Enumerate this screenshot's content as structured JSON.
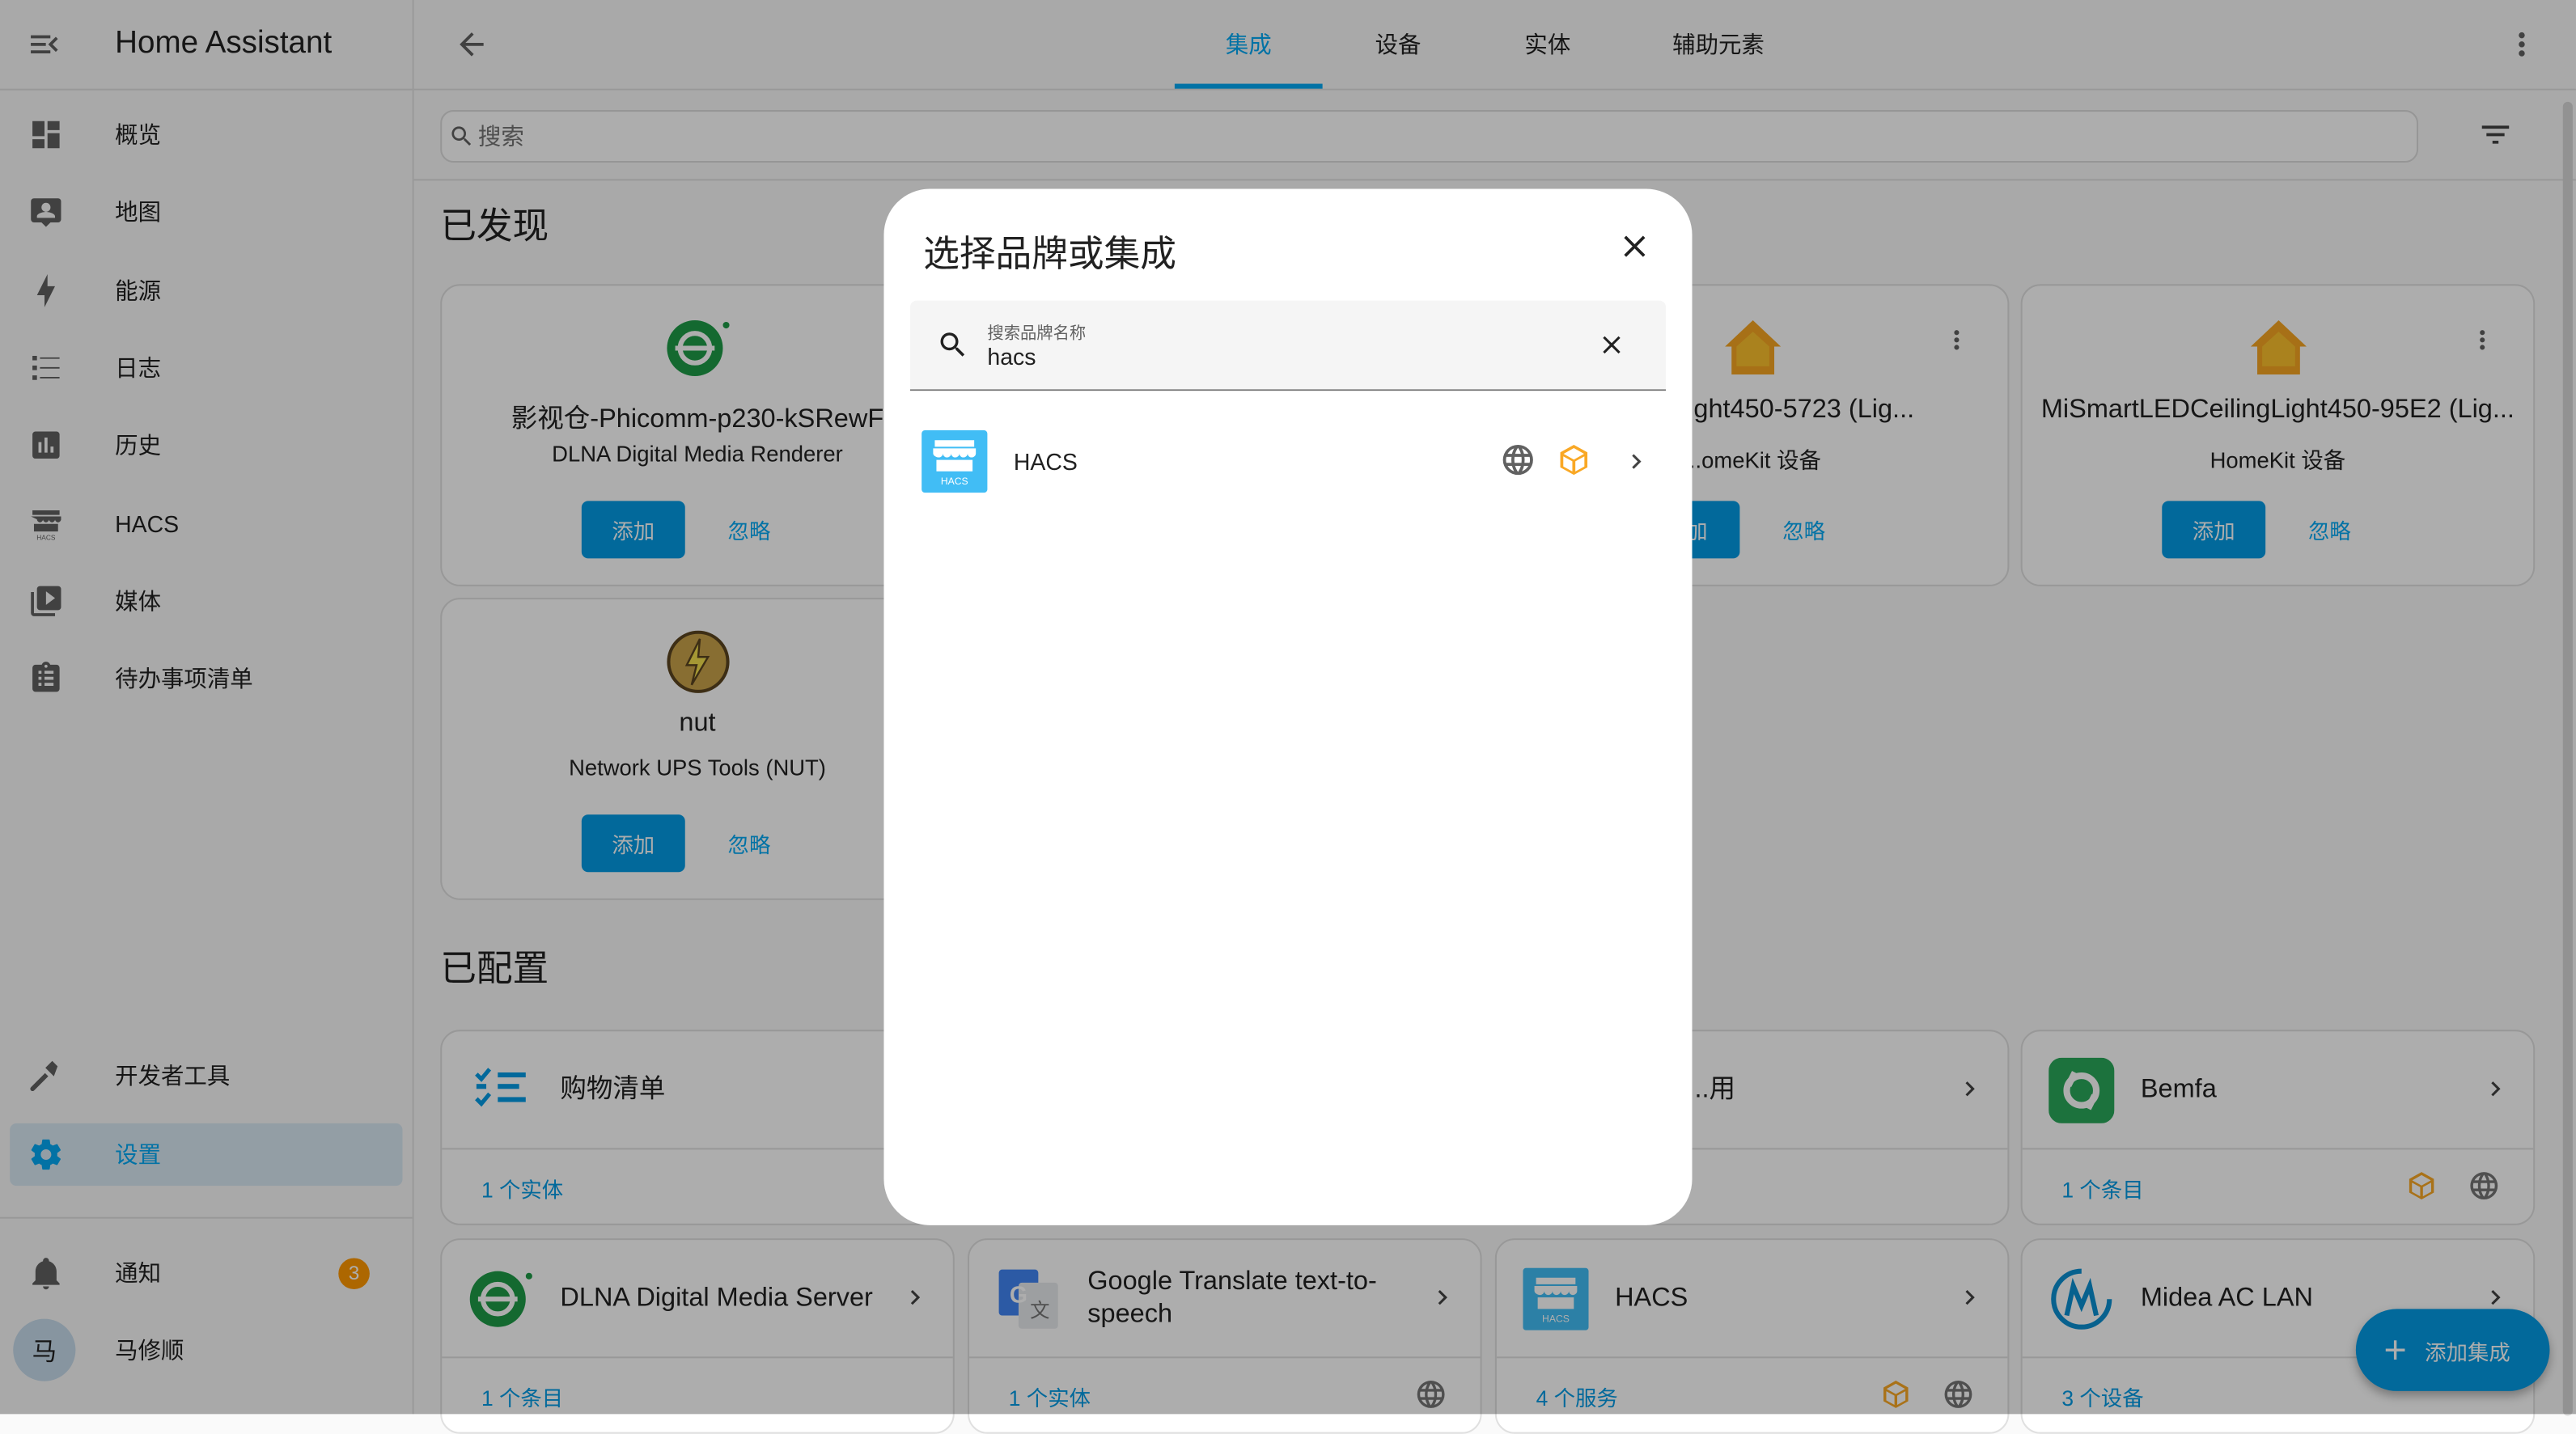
{
  "app": {
    "title": "Home Assistant"
  },
  "sidebar": {
    "items": [
      {
        "label": "概览"
      },
      {
        "label": "地图"
      },
      {
        "label": "能源"
      },
      {
        "label": "日志"
      },
      {
        "label": "历史"
      },
      {
        "label": "HACS"
      },
      {
        "label": "媒体"
      },
      {
        "label": "待办事项清单"
      }
    ],
    "dev_tools": "开发者工具",
    "settings": "设置",
    "notifications": "通知",
    "notifications_count": "3",
    "user_initial": "马",
    "user_name": "马修顺"
  },
  "tabs": [
    {
      "label": "集成",
      "active": true
    },
    {
      "label": "设备"
    },
    {
      "label": "实体"
    },
    {
      "label": "辅助元素"
    }
  ],
  "search": {
    "placeholder": "搜索"
  },
  "discovered": {
    "heading": "已发现",
    "cards": [
      {
        "name": "影视仓-Phicomm-p230-kSRewF",
        "sub": "DLNA Digital Media Renderer",
        "add": "添加",
        "ignore": "忽略"
      },
      {
        "name": "nut",
        "sub": "Network UPS Tools (NUT)",
        "add": "添加",
        "ignore": "忽略"
      },
      {
        "name": "...eilingLight450-5723 (Lig...",
        "sub": "...omeKit 设备",
        "add": "...加",
        "ignore": "忽略"
      },
      {
        "name": "MiSmartLEDCeilingLight450-95E2 (Lig...",
        "sub": "HomeKit 设备",
        "add": "添加",
        "ignore": "忽略"
      }
    ]
  },
  "configured": {
    "heading": "已配置",
    "cards": [
      {
        "name": "购物清单",
        "foot": "1 个实体"
      },
      {
        "name": "...用",
        "foot": ""
      },
      {
        "name": "Bemfa",
        "foot": "1 个条目"
      },
      {
        "name": "DLNA Digital Media Server",
        "foot": "1 个条目"
      },
      {
        "name": "Google Translate text-to-speech",
        "foot": "1 个实体"
      },
      {
        "name": "HACS",
        "foot": "4 个服务"
      },
      {
        "name": "Midea AC LAN",
        "foot": "3 个设备"
      }
    ]
  },
  "fab": {
    "label": "添加集成"
  },
  "dialog": {
    "title": "选择品牌或集成",
    "search_label": "搜索品牌名称",
    "search_value": "hacs",
    "results": [
      {
        "name": "HACS",
        "logo_text": "HACS"
      }
    ]
  },
  "colors": {
    "accent": "#03a9f4",
    "button": "#039be5",
    "badge": "#ff9800",
    "custom": "#f9a825"
  }
}
